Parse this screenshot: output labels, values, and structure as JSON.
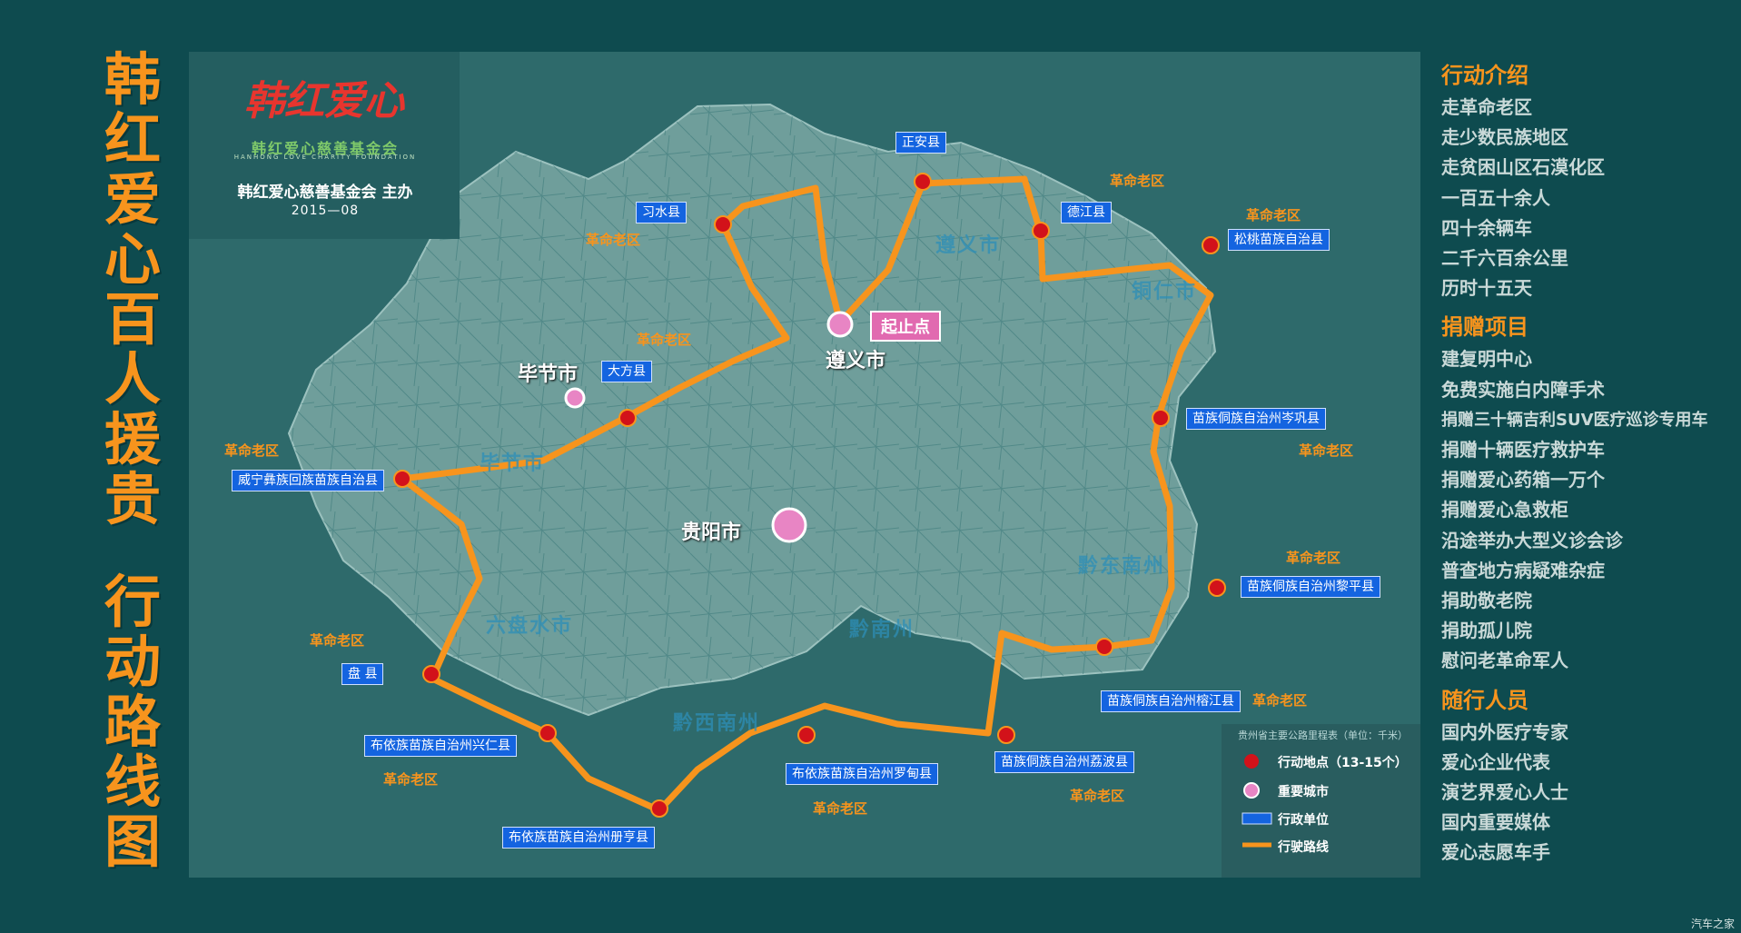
{
  "title_line1": [
    "韩",
    "红",
    "爱",
    "心",
    "百",
    "人",
    "援",
    "贵"
  ],
  "title_line2": [
    "行",
    "动",
    "路",
    "线",
    "图"
  ],
  "logo": {
    "script": "韩红爱心",
    "cn": "韩红爱心慈善基金会",
    "en": "HANHONG LOVE CHARITY FOUNDATION"
  },
  "organizer": "韩红爱心慈善基金会 主办",
  "date": "2015—08",
  "start_label": "起止点",
  "cities": {
    "zunyi": "遵义市",
    "guiyang": "贵阳市",
    "bijie": "毕节市"
  },
  "regions": [
    "遵义市",
    "铜仁市",
    "毕节市",
    "黔东南州",
    "六盘水市",
    "黔南州",
    "黔西南州"
  ],
  "stops": [
    "正安县",
    "习水县",
    "德江县",
    "松桃苗族自治县",
    "大方县",
    "威宁彝族回族苗族自治县",
    "苗族侗族自治州岑巩县",
    "苗族侗族自治州黎平县",
    "盘  县",
    "苗族侗族自治州榕江县",
    "布依族苗族自治州兴仁县",
    "布依族苗族自治州罗甸县",
    "苗族侗族自治州荔波县",
    "布依族苗族自治州册亨县"
  ],
  "laoqu": "革命老区",
  "legend": {
    "heading": "贵州省主要公路里程表（单位：千米）",
    "action": "行动地点（13-15个）",
    "city": "重要城市",
    "admin": "行政单位",
    "route": "行驶路线"
  },
  "colors": {
    "route": "#f7941d",
    "stop": "#d2121a",
    "city": "#e885c4",
    "label": "#1464e0"
  },
  "sections": [
    {
      "heading": "行动介绍",
      "items": [
        "走革命老区",
        "走少数民族地区",
        "走贫困山区石漠化区",
        "一百五十余人",
        "四十余辆车",
        "二千六百余公里",
        "历时十五天"
      ]
    },
    {
      "heading": "捐赠项目",
      "items": [
        "建复明中心",
        "免费实施白内障手术",
        "捐赠三十辆吉利SUV医疗巡诊专用车",
        "捐赠十辆医疗救护车",
        "捐赠爱心药箱一万个",
        "捐赠爱心急救柜",
        "沿途举办大型义诊会诊",
        "普查地方病疑难杂症",
        "捐助敬老院",
        "捐助孤儿院",
        "慰问老革命军人"
      ]
    },
    {
      "heading": "随行人员",
      "items": [
        "国内外医疗专家",
        "爱心企业代表",
        "演艺界爱心人士",
        "国内重要媒体",
        "爱心志愿车手"
      ]
    }
  ],
  "watermark": "汽车之家"
}
